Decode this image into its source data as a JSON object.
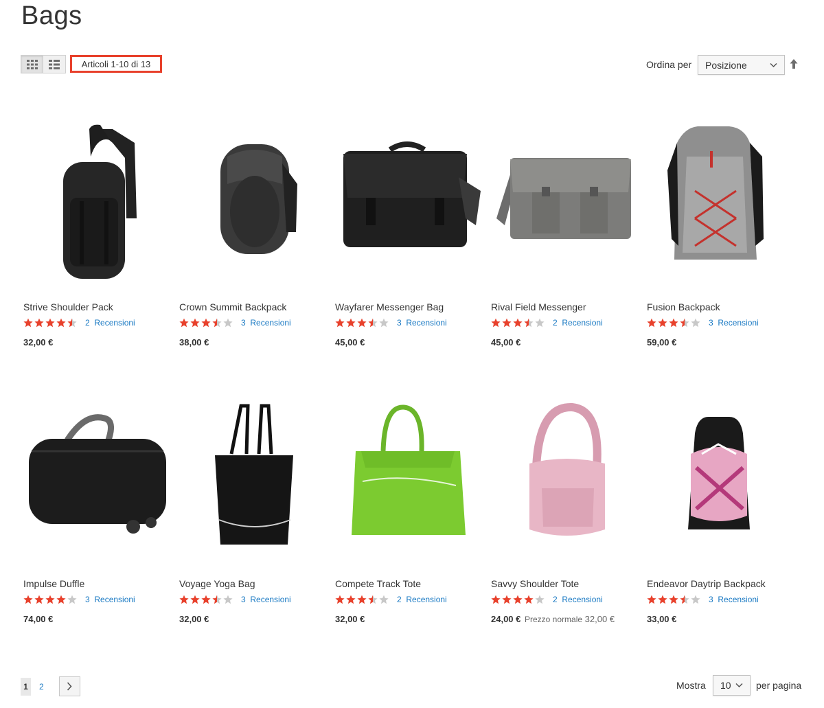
{
  "page": {
    "title": "Bags"
  },
  "toolbar": {
    "modes": [
      {
        "name": "grid",
        "active": true
      },
      {
        "name": "list",
        "active": false
      }
    ],
    "amount": "Articoli 1-10 di 13",
    "sort_label": "Ordina per",
    "sort_value": "Posizione"
  },
  "colors": {
    "star_on": "#e8412c",
    "star_off": "#c8c8c8",
    "link": "#1979c3",
    "highlight_border": "#e8412c"
  },
  "products": [
    {
      "name": "Strive Shoulder Pack",
      "rating": 4.5,
      "review_count": "2",
      "review_label": "Recensioni",
      "price": "32,00 €",
      "image": "black sling backpack"
    },
    {
      "name": "Crown Summit Backpack",
      "rating": 3.5,
      "review_count": "3",
      "review_label": "Recensioni",
      "price": "38,00 €",
      "image": "black backpack"
    },
    {
      "name": "Wayfarer Messenger Bag",
      "rating": 3.5,
      "review_count": "3",
      "review_label": "Recensioni",
      "price": "45,00 €",
      "image": "black messenger bag"
    },
    {
      "name": "Rival Field Messenger",
      "rating": 3.5,
      "review_count": "2",
      "review_label": "Recensioni",
      "price": "45,00 €",
      "image": "grey canvas messenger bag"
    },
    {
      "name": "Fusion Backpack",
      "rating": 3.5,
      "review_count": "3",
      "review_label": "Recensioni",
      "price": "59,00 €",
      "image": "grey and red backpack"
    },
    {
      "name": "Impulse Duffle",
      "rating": 4,
      "review_count": "3",
      "review_label": "Recensioni",
      "price": "74,00 €",
      "image": "black rolling duffle"
    },
    {
      "name": "Voyage Yoga Bag",
      "rating": 3.5,
      "review_count": "3",
      "review_label": "Recensioni",
      "price": "32,00 €",
      "image": "black tote bag"
    },
    {
      "name": "Compete Track Tote",
      "rating": 3.5,
      "review_count": "2",
      "review_label": "Recensioni",
      "price": "32,00 €",
      "image": "green gym tote"
    },
    {
      "name": "Savvy Shoulder Tote",
      "rating": 4,
      "review_count": "2",
      "review_label": "Recensioni",
      "price": "24,00 €",
      "old_price_label": "Prezzo normale",
      "old_price": "32,00 €",
      "image": "pink shoulder bag"
    },
    {
      "name": "Endeavor Daytrip Backpack",
      "rating": 3.5,
      "review_count": "3",
      "review_label": "Recensioni",
      "price": "33,00 €",
      "image": "black and pink backpack"
    }
  ],
  "pager": {
    "current": "1",
    "pages": [
      "2"
    ],
    "next_icon": "chevron-right-icon"
  },
  "limiter": {
    "label_before": "Mostra",
    "value": "10",
    "label_after": "per pagina"
  }
}
